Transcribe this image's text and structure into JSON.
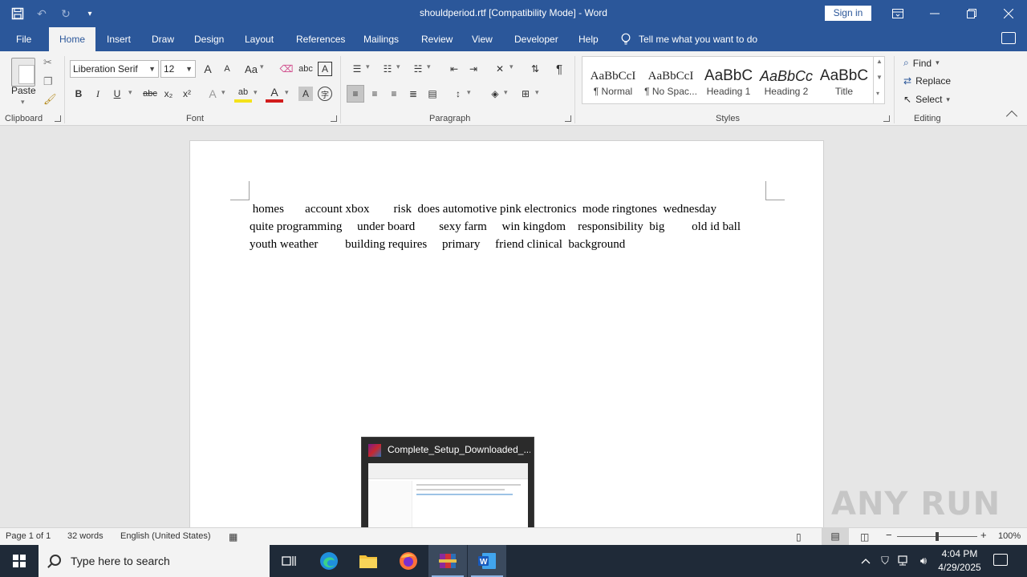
{
  "window": {
    "title": "shouldperiod.rtf [Compatibility Mode]  -  Word",
    "sign_in": "Sign in"
  },
  "tabs": [
    {
      "label": "File"
    },
    {
      "label": "Home"
    },
    {
      "label": "Insert"
    },
    {
      "label": "Draw"
    },
    {
      "label": "Design"
    },
    {
      "label": "Layout"
    },
    {
      "label": "References"
    },
    {
      "label": "Mailings"
    },
    {
      "label": "Review"
    },
    {
      "label": "View"
    },
    {
      "label": "Developer"
    },
    {
      "label": "Help"
    }
  ],
  "tell_me": "Tell me what you want to do",
  "ribbon": {
    "clipboard": {
      "paste": "Paste",
      "label": "Clipboard"
    },
    "font": {
      "label": "Font",
      "font_name": "Liberation Serif",
      "font_size": "12",
      "grow": "A",
      "shrink": "A",
      "change_case": "Aa",
      "bold": "B",
      "italic": "I",
      "underline": "U",
      "strike": "abc",
      "subscript": "x₂",
      "superscript": "x²",
      "effects": "A",
      "highlight": "ab",
      "font_color": "A",
      "char_shading": "A",
      "enclose": "字"
    },
    "paragraph": {
      "label": "Paragraph",
      "pilcrow": "¶"
    },
    "styles": {
      "label": "Styles",
      "items": [
        {
          "sample": "AaBbCcI",
          "name": "¶ Normal"
        },
        {
          "sample": "AaBbCcI",
          "name": "¶ No Spac..."
        },
        {
          "sample": "AaBbC",
          "name": "Heading 1"
        },
        {
          "sample": "AaBbCc",
          "name": "Heading 2"
        },
        {
          "sample": "AaBbC",
          "name": "Title"
        }
      ]
    },
    "editing": {
      "label": "Editing",
      "find": "Find",
      "replace": "Replace",
      "select": "Select"
    }
  },
  "document": {
    "text": " homes       account xbox        risk  does automotive pink electronics  mode ringtones  wednesday\nquite programming     under board        sexy farm     win kingdom    responsibility  big         old id ball\nyouth weather         building requires     primary     friend clinical  background"
  },
  "thumbnail": {
    "title": "Complete_Setup_Downloaded_..."
  },
  "status": {
    "page": "Page 1 of 1",
    "words": "32 words",
    "language": "English (United States)",
    "zoom": "100%",
    "watermark": "ANY RUN"
  },
  "taskbar": {
    "search_placeholder": "Type here to search",
    "time": "4:04 PM",
    "date": "4/29/2025"
  }
}
